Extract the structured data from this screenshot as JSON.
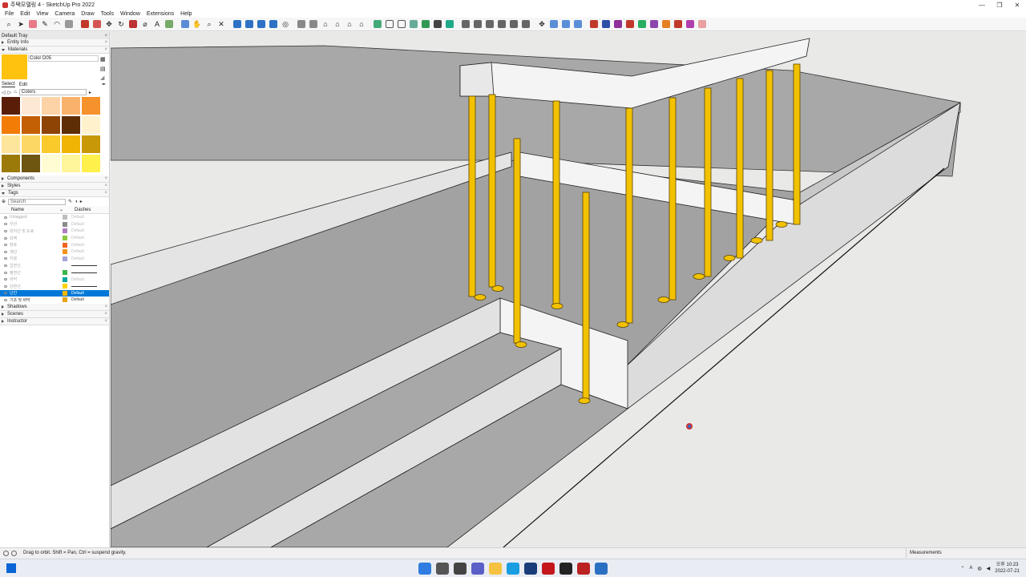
{
  "window": {
    "title": "주택모델링 4 - SketchUp Pro 2022",
    "controls": [
      "—",
      "❐",
      "✕"
    ]
  },
  "menu": [
    "File",
    "Edit",
    "View",
    "Camera",
    "Draw",
    "Tools",
    "Window",
    "Extensions",
    "Help"
  ],
  "tray": {
    "title": "Default Tray",
    "close": "×",
    "sections": {
      "entity_info": "Entity Info",
      "materials": "Materials",
      "components": "Components",
      "styles": "Styles",
      "tags": "Tags",
      "shadows": "Shadows",
      "scenes": "Scenes",
      "instructor": "Instructor"
    },
    "material": {
      "name": "Color D05",
      "current_color": "#ffc20e"
    },
    "material_tabs": {
      "select": "Select",
      "edit": "Edit"
    },
    "library": "Colors",
    "swatches": [
      "#5a1e08",
      "#fde8d4",
      "#fbd3a7",
      "#f9b26c",
      "#f6922b",
      "#f27c06",
      "#c35f04",
      "#8d4404",
      "#5e2e06",
      "#fff1cc",
      "#fde59b",
      "#fcd763",
      "#fac92a",
      "#f0b405",
      "#c89808",
      "#9c7a0a",
      "#6e5510",
      "#fffbd2",
      "#fff59a",
      "#fff04c"
    ],
    "tags": {
      "search_placeholder": "Search",
      "col_name": "Name",
      "col_dashes": "Dashes",
      "rows": [
        {
          "name": "Untagged",
          "color": "#bdbdbd",
          "dash": "Default",
          "visible": false
        },
        {
          "name": "우산",
          "color": "#8c8c8c",
          "dash": "Default",
          "visible": false
        },
        {
          "name": "대지선 및 도로",
          "color": "#b07dc0",
          "dash": "Default",
          "visible": false
        },
        {
          "name": "외벽",
          "color": "#8cc63f",
          "dash": "Default",
          "visible": false
        },
        {
          "name": "창호",
          "color": "#f26522",
          "dash": "Default",
          "visible": false
        },
        {
          "name": "계단",
          "color": "#f7941d",
          "dash": "Default",
          "visible": false
        },
        {
          "name": "지붕",
          "color": "#a3a3d8",
          "dash": "Default",
          "visible": false
        },
        {
          "name": "입면선",
          "color": "",
          "dash": "line",
          "visible": false
        },
        {
          "name": "평면선",
          "color": "#39b54a",
          "dash": "line",
          "visible": false
        },
        {
          "name": "바닥",
          "color": "#00a99d",
          "dash": "Default",
          "visible": false
        },
        {
          "name": "단면선",
          "color": "#ffd400",
          "dash": "line",
          "visible": false
        },
        {
          "name": "난간",
          "color": "#f7b500",
          "dash": "Default",
          "visible": true,
          "selected": true
        },
        {
          "name": "기초 및 바닥",
          "color": "#e8a317",
          "dash": "Default",
          "visible": true
        }
      ]
    }
  },
  "status": {
    "hint": "Drag to orbit. Shift = Pan, Ctrl = suspend gravity.",
    "measurements": "Measurements"
  },
  "taskbar": {
    "time": "오후 10:23",
    "date": "2022-07-21"
  }
}
